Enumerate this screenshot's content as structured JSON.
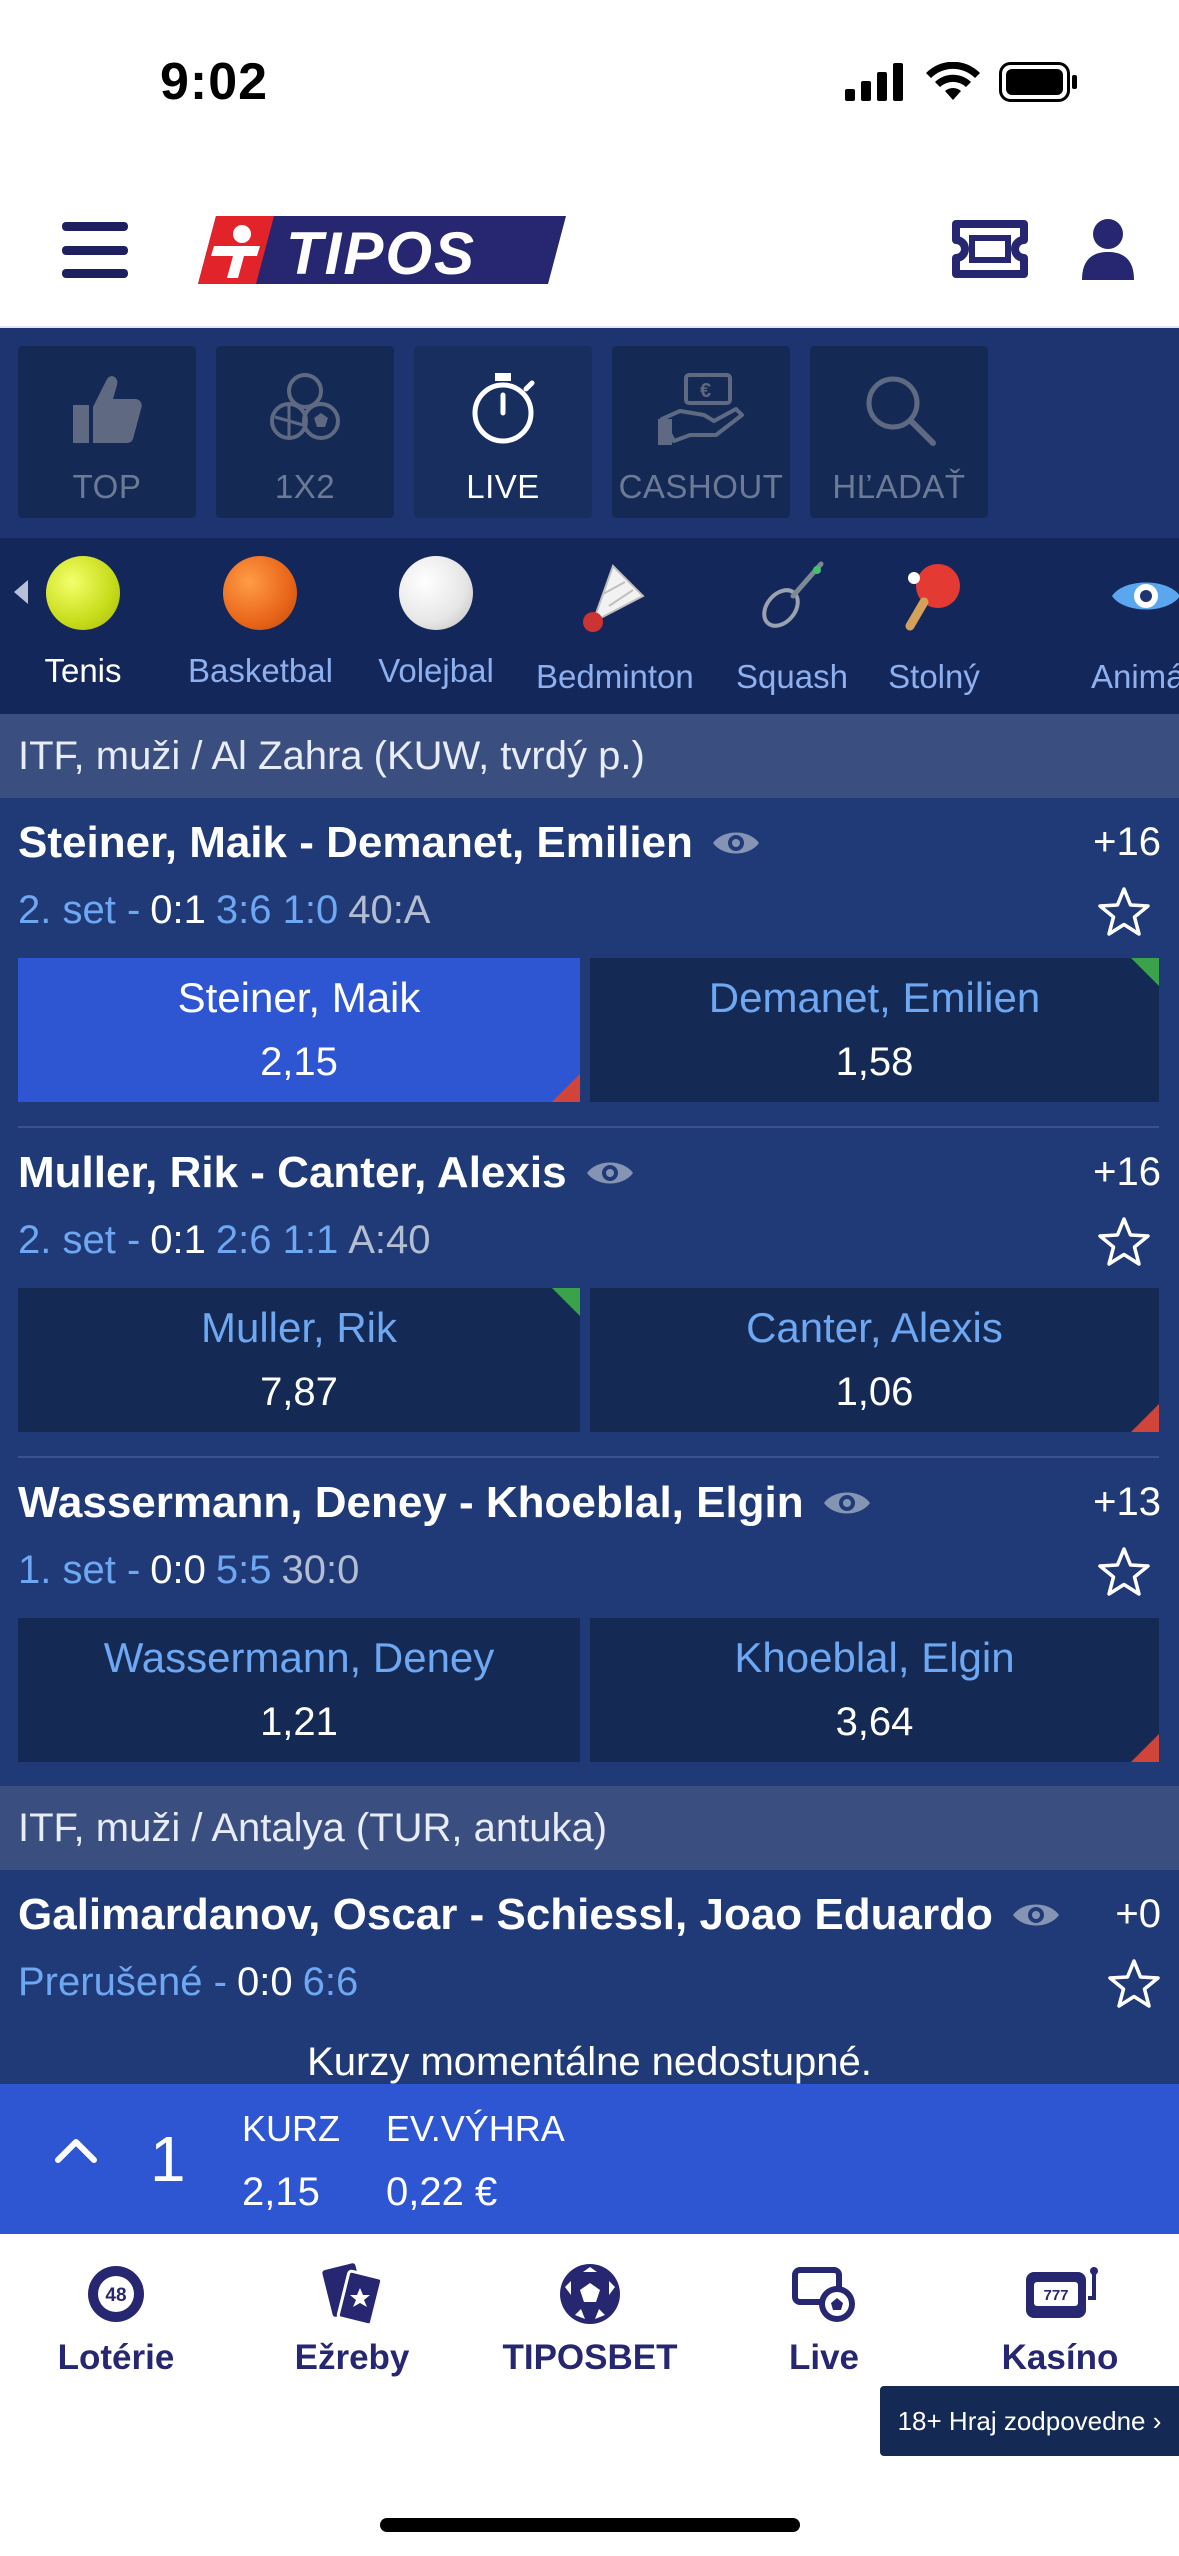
{
  "status": {
    "time": "9:02"
  },
  "header": {
    "logo_text": "TIPOS"
  },
  "topnav": [
    {
      "label": "TOP",
      "icon": "thumbs-up-icon"
    },
    {
      "label": "1X2",
      "icon": "sport-balls-icon"
    },
    {
      "label": "LIVE",
      "icon": "stopwatch-icon"
    },
    {
      "label": "CASHOUT",
      "icon": "cashout-hand-icon"
    },
    {
      "label": "HĽADAŤ",
      "icon": "search-icon"
    }
  ],
  "sports": [
    {
      "name": "Tenis",
      "icon": "tennis-ball-icon"
    },
    {
      "name": "Basketbal",
      "icon": "basketball-icon"
    },
    {
      "name": "Volejbal",
      "icon": "volleyball-icon"
    },
    {
      "name": "Bedminton",
      "icon": "shuttlecock-icon"
    },
    {
      "name": "Squash",
      "icon": "squash-racket-icon"
    },
    {
      "name": "Stolný",
      "icon": "table-tennis-icon"
    },
    {
      "name": "Animác",
      "icon": "eye-icon"
    }
  ],
  "leagues": [
    {
      "title": "ITF, muži / Al Zahra (KUW, tvrdý p.)"
    },
    {
      "title": "ITF, muži / Antalya (TUR, antuka)"
    }
  ],
  "matches": [
    {
      "title": "Steiner, Maik - Demanet, Emilien",
      "count": "+16",
      "set": "2. set -",
      "score": "0:1",
      "games": "3:6 1:0",
      "points": "40:A",
      "home": {
        "name": "Steiner, Maik",
        "odd": "2,15"
      },
      "away": {
        "name": "Demanet, Emilien",
        "odd": "1,58"
      }
    },
    {
      "title": "Muller, Rik - Canter, Alexis",
      "count": "+16",
      "set": "2. set -",
      "score": "0:1",
      "games": "2:6 1:1",
      "points": "A:40",
      "home": {
        "name": "Muller, Rik",
        "odd": "7,87"
      },
      "away": {
        "name": "Canter, Alexis",
        "odd": "1,06"
      }
    },
    {
      "title": "Wassermann, Deney - Khoeblal, Elgin",
      "count": "+13",
      "set": "1. set -",
      "score": "0:0",
      "games": "5:5",
      "points": "30:0",
      "home": {
        "name": "Wassermann, Deney",
        "odd": "1,21"
      },
      "away": {
        "name": "Khoeblal, Elgin",
        "odd": "3,64"
      }
    },
    {
      "title": "Galimardanov, Oscar - Schiessl, Joao Eduardo",
      "count": "+0",
      "set": "Prerušené -",
      "score": "0:0",
      "games": "6:6",
      "points": "",
      "unavailable": "Kurzy momentálne nedostupné."
    }
  ],
  "betslip": {
    "count": "1",
    "odds_label": "KURZ",
    "odds_value": "2,15",
    "win_label": "EV.VÝHRA",
    "win_value": "0,22 €"
  },
  "bottomnav": [
    {
      "label": "Lotérie",
      "icon": "lottery-ball-icon",
      "badge": "48"
    },
    {
      "label": "Ežreby",
      "icon": "e-tickets-icon"
    },
    {
      "label": "TIPOSBET",
      "icon": "soccer-ball-icon"
    },
    {
      "label": "Live",
      "icon": "live-screen-ball-icon"
    },
    {
      "label": "Kasíno",
      "icon": "slot-machine-icon",
      "badge": "777"
    }
  ],
  "responsible_gaming": "18+ Hraj zodpovedne ›",
  "colors": {
    "brand_navy": "#262770",
    "brand_red": "#e2232a",
    "selected_blue": "#2e56d2",
    "odds_up": "#3aa24a",
    "odds_down": "#d1443a"
  }
}
